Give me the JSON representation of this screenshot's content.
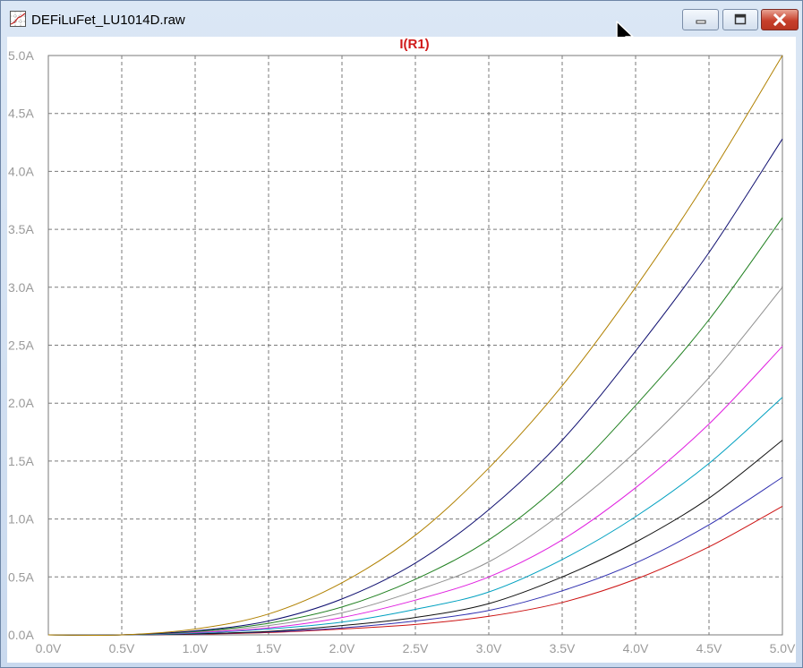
{
  "window": {
    "title": "DEFiLuFet_LU1014D.raw",
    "buttons": {
      "minimize": "minimize-icon",
      "maximize": "maximize-icon",
      "close": "close-icon"
    }
  },
  "colors": {
    "title": "#d01a1a",
    "grid": "#7a7a7a",
    "tick_labels": "#9a9a9a",
    "series": [
      "#cc1111",
      "#3030b0",
      "#101010",
      "#00a0c0",
      "#e020e0",
      "#909090",
      "#208020",
      "#101070",
      "#b08000"
    ]
  },
  "chart_data": {
    "type": "line",
    "title": "I(R1)",
    "xlabel": "",
    "ylabel": "",
    "xlim": [
      0,
      5
    ],
    "ylim": [
      0,
      5
    ],
    "x_unit": "V",
    "y_unit": "A",
    "x_ticks": [
      "0.0V",
      "0.5V",
      "1.0V",
      "1.5V",
      "2.0V",
      "2.5V",
      "3.0V",
      "3.5V",
      "4.0V",
      "4.5V",
      "5.0V"
    ],
    "y_ticks": [
      "0.0A",
      "0.5A",
      "1.0A",
      "1.5A",
      "2.0A",
      "2.5A",
      "3.0A",
      "3.5A",
      "4.0A",
      "4.5A",
      "5.0A"
    ],
    "grid": true,
    "x": [
      0.0,
      0.5,
      1.0,
      1.5,
      2.0,
      2.5,
      3.0,
      3.5,
      4.0,
      4.5,
      5.0
    ],
    "series": [
      {
        "values": [
          0,
          0,
          0.005,
          0.02,
          0.05,
          0.09,
          0.16,
          0.28,
          0.48,
          0.76,
          1.11
        ]
      },
      {
        "values": [
          0,
          0,
          0.008,
          0.025,
          0.06,
          0.12,
          0.21,
          0.38,
          0.62,
          0.95,
          1.36
        ]
      },
      {
        "values": [
          0,
          0,
          0.01,
          0.03,
          0.08,
          0.15,
          0.27,
          0.5,
          0.8,
          1.18,
          1.68
        ]
      },
      {
        "values": [
          0,
          0,
          0.015,
          0.05,
          0.11,
          0.22,
          0.37,
          0.65,
          1.02,
          1.48,
          2.05
        ]
      },
      {
        "values": [
          0,
          0,
          0.02,
          0.06,
          0.15,
          0.3,
          0.5,
          0.82,
          1.27,
          1.82,
          2.49
        ]
      },
      {
        "values": [
          0,
          0,
          0.025,
          0.08,
          0.19,
          0.38,
          0.63,
          1.05,
          1.58,
          2.22,
          3.0
        ]
      },
      {
        "values": [
          0,
          0,
          0.03,
          0.1,
          0.24,
          0.48,
          0.82,
          1.32,
          1.98,
          2.72,
          3.6
        ]
      },
      {
        "values": [
          0,
          0,
          0.035,
          0.12,
          0.31,
          0.62,
          1.08,
          1.68,
          2.45,
          3.3,
          4.28
        ]
      },
      {
        "values": [
          0,
          0,
          0.05,
          0.18,
          0.45,
          0.86,
          1.44,
          2.15,
          3.0,
          3.95,
          5.0
        ]
      }
    ]
  }
}
